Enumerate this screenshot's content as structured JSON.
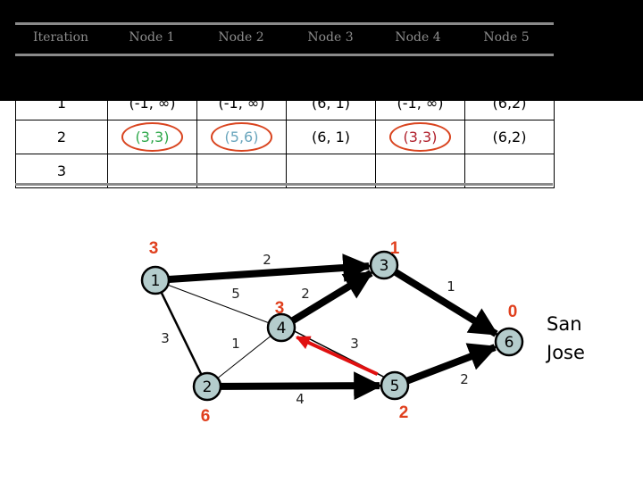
{
  "table": {
    "headers": [
      "Iteration",
      "Node 1",
      "Node 2",
      "Node 3",
      "Node 4",
      "Node 5"
    ],
    "rows": [
      {
        "iteration": "1",
        "cells": [
          "(-1, ∞)",
          "(-1, ∞)",
          "(6, 1)",
          "(-1, ∞)",
          "(6,2)"
        ]
      },
      {
        "iteration": "2",
        "cells": [
          "(3,3)",
          "(5,6)",
          "(6, 1)",
          "(3,3)",
          "(6,2)"
        ],
        "highlighted": [
          true,
          true,
          false,
          true,
          false
        ],
        "cell_colors": [
          "#2ea84a",
          "#6aa6bd",
          "#000000",
          "#b0202c",
          "#000000"
        ]
      },
      {
        "iteration": "3",
        "cells": [
          "",
          "",
          "",
          "",
          ""
        ]
      }
    ],
    "highlight_ring_color": "#d9441f"
  },
  "graph": {
    "node_fill": "#b4cccc",
    "distance_color": "#e0401e",
    "nodes": [
      {
        "id": "1",
        "distance": "3"
      },
      {
        "id": "2",
        "distance": "6"
      },
      {
        "id": "3",
        "distance": "1"
      },
      {
        "id": "4",
        "distance": "3"
      },
      {
        "id": "5",
        "distance": "2"
      },
      {
        "id": "6",
        "distance": "0"
      }
    ],
    "edges": [
      {
        "from": "1",
        "to": "3",
        "weight": "2",
        "style": "bold-arrow"
      },
      {
        "from": "1",
        "to": "4",
        "weight": "5",
        "style": "thin"
      },
      {
        "from": "1",
        "to": "2",
        "weight": "3",
        "style": "medium"
      },
      {
        "from": "4",
        "to": "3",
        "weight": "2",
        "style": "bold-arrow"
      },
      {
        "from": "3",
        "to": "6",
        "weight": "1",
        "style": "bold-arrow"
      },
      {
        "from": "2",
        "to": "4",
        "weight": "1",
        "style": "thin"
      },
      {
        "from": "5",
        "to": "4",
        "weight": "3",
        "style": "highlight-arrow"
      },
      {
        "from": "2",
        "to": "5",
        "weight": "4",
        "style": "bold-arrow"
      },
      {
        "from": "5",
        "to": "6",
        "weight": "2",
        "style": "bold-arrow"
      }
    ],
    "highlight_edge_color": "#e01010",
    "destination_label": "San Jose"
  }
}
